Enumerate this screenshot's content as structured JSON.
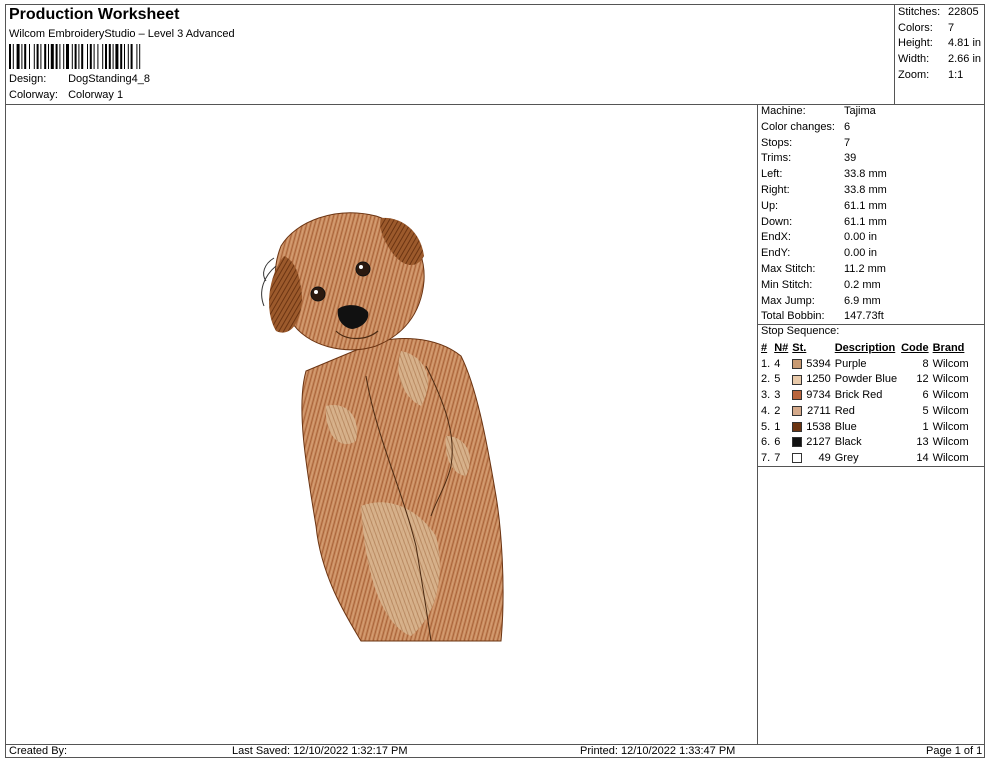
{
  "header": {
    "title": "Production Worksheet",
    "software": "Wilcom EmbroideryStudio – Level 3 Advanced",
    "design_label": "Design:",
    "design_value": "DogStanding4_8",
    "colorway_label": "Colorway:",
    "colorway_value": "Colorway 1"
  },
  "summary": {
    "stitches_label": "Stitches:",
    "stitches_value": "22805",
    "colors_label": "Colors:",
    "colors_value": "7",
    "height_label": "Height:",
    "height_value": "4.81 in",
    "width_label": "Width:",
    "width_value": "2.66 in",
    "zoom_label": "Zoom:",
    "zoom_value": "1:1"
  },
  "details": [
    {
      "k": "Machine:",
      "v": "Tajima"
    },
    {
      "k": "Color changes:",
      "v": "6"
    },
    {
      "k": "Stops:",
      "v": "7"
    },
    {
      "k": "Trims:",
      "v": "39"
    },
    {
      "k": "Left:",
      "v": "33.8 mm"
    },
    {
      "k": "Right:",
      "v": "33.8 mm"
    },
    {
      "k": "Up:",
      "v": "61.1 mm"
    },
    {
      "k": "Down:",
      "v": "61.1 mm"
    },
    {
      "k": "EndX:",
      "v": "0.00 in"
    },
    {
      "k": "EndY:",
      "v": "0.00 in"
    },
    {
      "k": "Max Stitch:",
      "v": "11.2 mm"
    },
    {
      "k": "Min Stitch:",
      "v": "0.2 mm"
    },
    {
      "k": "Max Jump:",
      "v": "6.9 mm"
    },
    {
      "k": "Total Bobbin:",
      "v": "147.73ft"
    }
  ],
  "sequence": {
    "title": "Stop Sequence:",
    "headers": {
      "num": "#",
      "n": "N#",
      "st": "St.",
      "desc": "Description",
      "code": "Code",
      "brand": "Brand"
    },
    "rows": [
      {
        "num": "1.",
        "n": "4",
        "color": "#c89a72",
        "st": "5394",
        "desc": "Purple",
        "code": "8",
        "brand": "Wilcom"
      },
      {
        "num": "2.",
        "n": "5",
        "color": "#e8c9a9",
        "st": "1250",
        "desc": "Powder Blue",
        "code": "12",
        "brand": "Wilcom"
      },
      {
        "num": "3.",
        "n": "3",
        "color": "#b8643c",
        "st": "9734",
        "desc": "Brick Red",
        "code": "6",
        "brand": "Wilcom"
      },
      {
        "num": "4.",
        "n": "2",
        "color": "#d4a98a",
        "st": "2711",
        "desc": "Red",
        "code": "5",
        "brand": "Wilcom"
      },
      {
        "num": "5.",
        "n": "1",
        "color": "#6b3412",
        "st": "1538",
        "desc": "Blue",
        "code": "1",
        "brand": "Wilcom"
      },
      {
        "num": "6.",
        "n": "6",
        "color": "#111111",
        "st": "2127",
        "desc": "Black",
        "code": "13",
        "brand": "Wilcom"
      },
      {
        "num": "7.",
        "n": "7",
        "color": "#ffffff",
        "st": "49",
        "desc": "Grey",
        "code": "14",
        "brand": "Wilcom"
      }
    ]
  },
  "footer": {
    "created": "Created By:",
    "saved": "Last Saved: 12/10/2022 1:32:17 PM",
    "printed": "Printed: 12/10/2022 1:33:47 PM",
    "page": "Page 1 of 1"
  }
}
